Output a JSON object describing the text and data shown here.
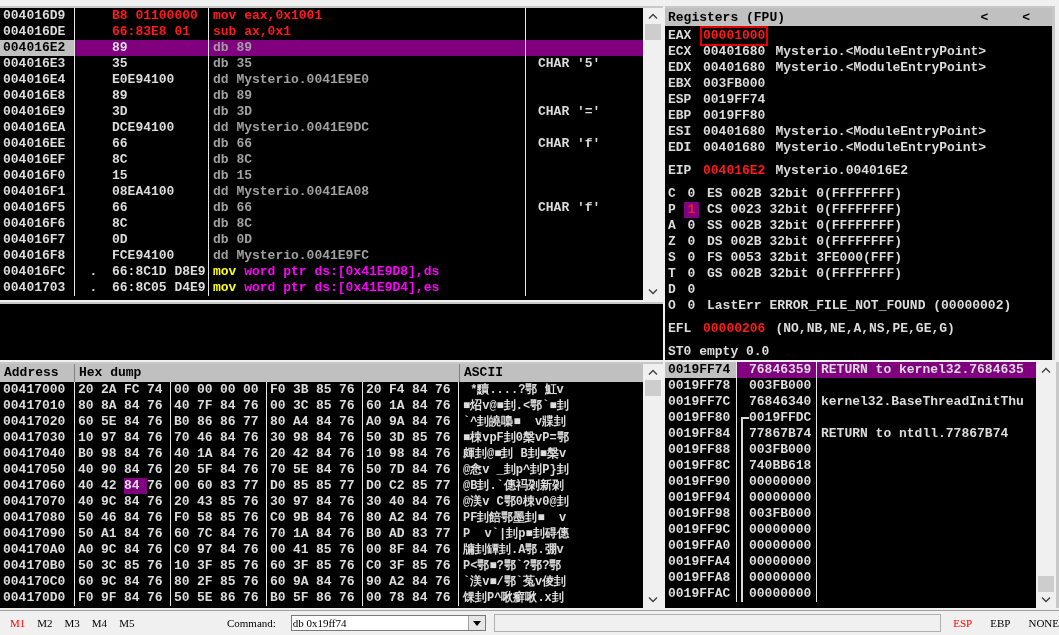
{
  "disassembly": {
    "rows": [
      {
        "address": "004016D9",
        "hex": "B8 01100000",
        "hex_changed": true,
        "instruction": [
          {
            "text": "mov eax,0x1001",
            "kind": "changed"
          }
        ],
        "selected": false
      },
      {
        "address": "004016DE",
        "hex": "66:83E8 01",
        "hex_changed": true,
        "instruction": [
          {
            "text": "sub ax,0x1",
            "kind": "changed"
          }
        ],
        "selected": false
      },
      {
        "address": "004016E2",
        "hex": "89",
        "hex_changed": false,
        "instruction": [
          {
            "text": "db 89",
            "kind": "data"
          }
        ],
        "selected": true
      },
      {
        "address": "004016E3",
        "hex": "35",
        "hex_changed": false,
        "instruction": [
          {
            "text": "db 35",
            "kind": "data"
          }
        ],
        "comment": "CHAR '5'",
        "selected": false
      },
      {
        "address": "004016E4",
        "hex": "E0E94100",
        "hex_changed": false,
        "instruction": [
          {
            "text": "dd Mysterio.0041E9E0",
            "kind": "data"
          }
        ],
        "selected": false
      },
      {
        "address": "004016E8",
        "hex": "89",
        "hex_changed": false,
        "instruction": [
          {
            "text": "db 89",
            "kind": "data"
          }
        ],
        "selected": false
      },
      {
        "address": "004016E9",
        "hex": "3D",
        "hex_changed": false,
        "instruction": [
          {
            "text": "db 3D",
            "kind": "data"
          }
        ],
        "comment": "CHAR '='",
        "selected": false
      },
      {
        "address": "004016EA",
        "hex": "DCE94100",
        "hex_changed": false,
        "instruction": [
          {
            "text": "dd Mysterio.0041E9DC",
            "kind": "data"
          }
        ],
        "selected": false
      },
      {
        "address": "004016EE",
        "hex": "66",
        "hex_changed": false,
        "instruction": [
          {
            "text": "db 66",
            "kind": "data"
          }
        ],
        "comment": "CHAR 'f'",
        "selected": false
      },
      {
        "address": "004016EF",
        "hex": "8C",
        "hex_changed": false,
        "instruction": [
          {
            "text": "db 8C",
            "kind": "data"
          }
        ],
        "selected": false
      },
      {
        "address": "004016F0",
        "hex": "15",
        "hex_changed": false,
        "instruction": [
          {
            "text": "db 15",
            "kind": "data"
          }
        ],
        "selected": false
      },
      {
        "address": "004016F1",
        "hex": "08EA4100",
        "hex_changed": false,
        "instruction": [
          {
            "text": "dd Mysterio.0041EA08",
            "kind": "data"
          }
        ],
        "selected": false
      },
      {
        "address": "004016F5",
        "hex": "66",
        "hex_changed": false,
        "instruction": [
          {
            "text": "db 66",
            "kind": "data"
          }
        ],
        "comment": "CHAR 'f'",
        "selected": false
      },
      {
        "address": "004016F6",
        "hex": "8C",
        "hex_changed": false,
        "instruction": [
          {
            "text": "db 8C",
            "kind": "data"
          }
        ],
        "selected": false
      },
      {
        "address": "004016F7",
        "hex": "0D",
        "hex_changed": false,
        "instruction": [
          {
            "text": "db 0D",
            "kind": "data"
          }
        ],
        "selected": false
      },
      {
        "address": "004016F8",
        "hex": "FCE94100",
        "hex_changed": false,
        "instruction": [
          {
            "text": "dd Mysterio.0041E9FC",
            "kind": "data"
          }
        ],
        "selected": false
      },
      {
        "address": "004016FC",
        "marker": ".",
        "hex": "66:8C1D D8E9",
        "hex_changed": false,
        "instruction": [
          {
            "text": "mov",
            "kind": "mnemonic"
          },
          {
            "text": "word ptr ds:[0x41E9D8],ds",
            "kind": "operand"
          }
        ],
        "selected": false
      },
      {
        "address": "00401703",
        "marker": ".",
        "hex": "66:8C05 D4E9",
        "hex_changed": false,
        "instruction": [
          {
            "text": "mov",
            "kind": "mnemonic"
          },
          {
            "text": "word ptr ds:[0x41E9D4],es",
            "kind": "operand"
          }
        ],
        "selected": false
      }
    ]
  },
  "registers": {
    "title": "Registers (FPU)",
    "header_buttons": [
      "<",
      "<"
    ],
    "general": [
      {
        "name": "EAX",
        "value": "00001000",
        "changed": true,
        "boxed": true
      },
      {
        "name": "ECX",
        "value": "00401680",
        "changed": false,
        "boxed": false,
        "comment": "Mysterio.<ModuleEntryPoint>"
      },
      {
        "name": "EDX",
        "value": "00401680",
        "changed": false,
        "boxed": false,
        "comment": "Mysterio.<ModuleEntryPoint>"
      },
      {
        "name": "EBX",
        "value": "003FB000",
        "changed": false,
        "boxed": false
      },
      {
        "name": "ESP",
        "value": "0019FF74",
        "changed": false,
        "boxed": false
      },
      {
        "name": "EBP",
        "value": "0019FF80",
        "changed": false,
        "boxed": false
      },
      {
        "name": "ESI",
        "value": "00401680",
        "changed": false,
        "boxed": false,
        "comment": "Mysterio.<ModuleEntryPoint>"
      },
      {
        "name": "EDI",
        "value": "00401680",
        "changed": false,
        "boxed": false,
        "comment": "Mysterio.<ModuleEntryPoint>"
      }
    ],
    "eip": {
      "name": "EIP",
      "value": "004016E2",
      "changed": true,
      "comment": "Mysterio.004016E2"
    },
    "flags": [
      {
        "name": "C",
        "value": "0",
        "changed": false,
        "info": "ES 002B 32bit 0(FFFFFFFF)"
      },
      {
        "name": "P",
        "value": "1",
        "changed": true,
        "info": "CS 0023 32bit 0(FFFFFFFF)"
      },
      {
        "name": "A",
        "value": "0",
        "changed": false,
        "info": "SS 002B 32bit 0(FFFFFFFF)"
      },
      {
        "name": "Z",
        "value": "0",
        "changed": false,
        "info": "DS 002B 32bit 0(FFFFFFFF)"
      },
      {
        "name": "S",
        "value": "0",
        "changed": false,
        "info": "FS 0053 32bit 3FE000(FFF)"
      },
      {
        "name": "T",
        "value": "0",
        "changed": false,
        "info": "GS 002B 32bit 0(FFFFFFFF)"
      },
      {
        "name": "D",
        "value": "0",
        "changed": false
      },
      {
        "name": "O",
        "value": "0",
        "changed": false,
        "info": "LastErr ERROR_FILE_NOT_FOUND (00000002)"
      }
    ],
    "efl": {
      "name": "EFL",
      "value": "00000206",
      "changed": true,
      "comment": "(NO,NB,NE,A,NS,PE,GE,G)"
    },
    "fpu_line": "ST0 empty 0.0"
  },
  "hex_dump": {
    "columns": [
      "Address",
      "Hex dump",
      "ASCII"
    ],
    "rows": [
      {
        "address": "00417000",
        "bytes": [
          "20",
          "2A",
          "FC",
          "74",
          "00",
          "00",
          "00",
          "00",
          "F0",
          "3B",
          "85",
          "76",
          "20",
          "F4",
          "84",
          "76"
        ],
        "ascii": " *黷....?鄂 魟v"
      },
      {
        "address": "00417010",
        "bytes": [
          "80",
          "8A",
          "84",
          "76",
          "40",
          "7F",
          "84",
          "76",
          "00",
          "3C",
          "85",
          "76",
          "60",
          "1A",
          "84",
          "76"
        ],
        "ascii": "■炤v@■刲.<鄂`■刲"
      },
      {
        "address": "00417020",
        "bytes": [
          "60",
          "5E",
          "84",
          "76",
          "B0",
          "86",
          "86",
          "77",
          "80",
          "A4",
          "84",
          "76",
          "A0",
          "9A",
          "84",
          "76"
        ],
        "ascii": "`^刲皢嘄■  v牃刲"
      },
      {
        "address": "00417030",
        "bytes": [
          "10",
          "97",
          "84",
          "76",
          "70",
          "46",
          "84",
          "76",
          "30",
          "98",
          "84",
          "76",
          "50",
          "3D",
          "85",
          "76"
        ],
        "ascii": "■梀vpF刲0槃vP=鄂"
      },
      {
        "address": "00417040",
        "bytes": [
          "B0",
          "98",
          "84",
          "76",
          "40",
          "1A",
          "84",
          "76",
          "20",
          "42",
          "84",
          "76",
          "10",
          "98",
          "84",
          "76"
        ],
        "ascii": "皹刲@■刲 B刲■槃v"
      },
      {
        "address": "00417050",
        "bytes": [
          "40",
          "90",
          "84",
          "76",
          "20",
          "5F",
          "84",
          "76",
          "70",
          "5E",
          "84",
          "76",
          "50",
          "7D",
          "84",
          "76"
        ],
        "ascii": "@悆v _刲p^刲P}刲"
      },
      {
        "address": "00417060",
        "bytes": [
          "40",
          "42",
          {
            "text": "84",
            "selected": true
          },
          "76",
          "00",
          "60",
          "83",
          "77",
          "D0",
          "85",
          "85",
          "77",
          "D0",
          "C2",
          "85",
          "77"
        ],
        "ascii": "@B刲.`僡祃刴新刴"
      },
      {
        "address": "00417070",
        "bytes": [
          "40",
          "9C",
          "84",
          "76",
          "20",
          "43",
          "85",
          "76",
          "30",
          "97",
          "84",
          "76",
          "30",
          "40",
          "84",
          "76"
        ],
        "ascii": "@渼v C鄂0梀v0@刲"
      },
      {
        "address": "00417080",
        "bytes": [
          "50",
          "46",
          "84",
          "76",
          "F0",
          "58",
          "85",
          "76",
          "C0",
          "9B",
          "84",
          "76",
          "80",
          "A2",
          "84",
          "76"
        ],
        "ascii": "PF刲餢鄂墨刲■  v"
      },
      {
        "address": "00417090",
        "bytes": [
          "50",
          "A1",
          "84",
          "76",
          "60",
          "7C",
          "84",
          "76",
          "70",
          "1A",
          "84",
          "76",
          "B0",
          "AD",
          "83",
          "77"
        ],
        "ascii": "P  v`|刲p■刲碍僡"
      },
      {
        "address": "004170A0",
        "bytes": [
          "A0",
          "9C",
          "84",
          "76",
          "C0",
          "97",
          "84",
          "76",
          "00",
          "41",
          "85",
          "76",
          "00",
          "8F",
          "84",
          "76"
        ],
        "ascii": "牗刲罈刲.A鄂.弸v"
      },
      {
        "address": "004170B0",
        "bytes": [
          "50",
          "3C",
          "85",
          "76",
          "10",
          "3F",
          "85",
          "76",
          "60",
          "3F",
          "85",
          "76",
          "C0",
          "3F",
          "85",
          "76"
        ],
        "ascii": "P<鄂■?鄂`?鄂?鄂"
      },
      {
        "address": "004170C0",
        "bytes": [
          "60",
          "9C",
          "84",
          "76",
          "80",
          "2F",
          "85",
          "76",
          "60",
          "9A",
          "84",
          "76",
          "90",
          "A2",
          "84",
          "76"
        ],
        "ascii": "`渼v■/鄂`菟v倰刲"
      },
      {
        "address": "004170D0",
        "bytes": [
          "F0",
          "9F",
          "84",
          "76",
          "50",
          "5E",
          "86",
          "76",
          "B0",
          "5F",
          "86",
          "76",
          "00",
          "78",
          "84",
          "76"
        ],
        "ascii": "馃刲P^啾癬啾.x刲"
      }
    ]
  },
  "stack": {
    "rows": [
      {
        "address": "0019FF74",
        "value": "76846359",
        "comment": "RETURN to kernel32.7684635",
        "kind": "plain",
        "selected": true
      },
      {
        "address": "0019FF78",
        "value": "003FB000",
        "kind": "plain",
        "selected": false
      },
      {
        "address": "0019FF7C",
        "value": "76846340",
        "comment": "kernel32.BaseThreadInitThu",
        "kind": "plain",
        "selected": false
      },
      {
        "address": "0019FF80",
        "value": "0019FFDC",
        "kind": "framestart",
        "selected": false
      },
      {
        "address": "0019FF84",
        "value": "77867B74",
        "comment": "RETURN to ntdll.77867B74",
        "kind": "framed",
        "selected": false
      },
      {
        "address": "0019FF88",
        "value": "003FB000",
        "kind": "framed",
        "selected": false
      },
      {
        "address": "0019FF8C",
        "value": "740BB618",
        "kind": "framed",
        "selected": false
      },
      {
        "address": "0019FF90",
        "value": "00000000",
        "kind": "framed",
        "selected": false
      },
      {
        "address": "0019FF94",
        "value": "00000000",
        "kind": "framed",
        "selected": false
      },
      {
        "address": "0019FF98",
        "value": "003FB000",
        "kind": "framed",
        "selected": false
      },
      {
        "address": "0019FF9C",
        "value": "00000000",
        "kind": "framed",
        "selected": false
      },
      {
        "address": "0019FFA0",
        "value": "00000000",
        "kind": "framed",
        "selected": false
      },
      {
        "address": "0019FFA4",
        "value": "00000000",
        "kind": "framed",
        "selected": false
      },
      {
        "address": "0019FFA8",
        "value": "00000000",
        "kind": "framed",
        "selected": false
      },
      {
        "address": "0019FFAC",
        "value": "00000000",
        "kind": "framed",
        "selected": false
      }
    ]
  },
  "command_bar": {
    "memory_buttons": [
      {
        "label": "M1",
        "selected": true
      },
      {
        "label": "M2",
        "selected": false
      },
      {
        "label": "M3",
        "selected": false
      },
      {
        "label": "M4",
        "selected": false
      },
      {
        "label": "M5",
        "selected": false
      }
    ],
    "command_label": "Command:",
    "command_value": "db 0x19ff74",
    "register_options": [
      {
        "label": "ESP",
        "selected": true
      },
      {
        "label": "EBP",
        "selected": false
      },
      {
        "label": "NONE",
        "selected": false
      }
    ]
  }
}
